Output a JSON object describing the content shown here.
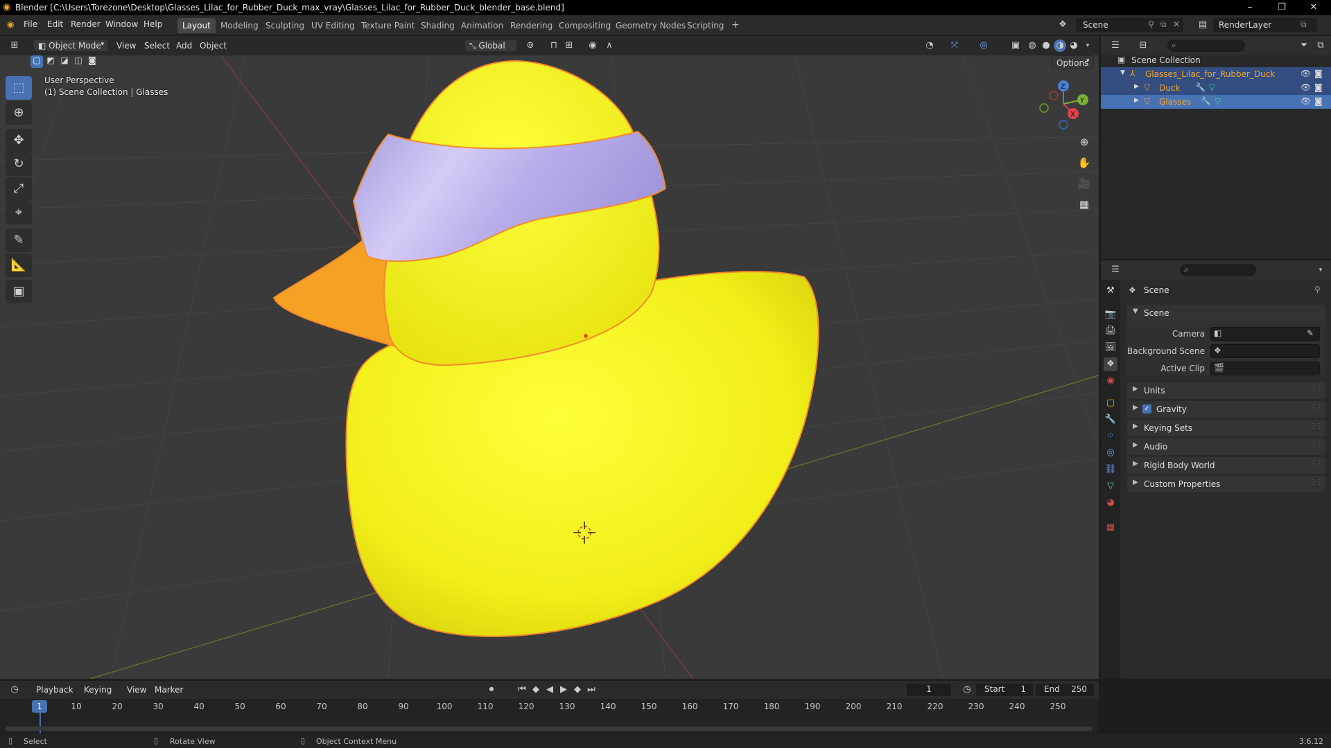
{
  "title_bar": {
    "title": "Blender [C:\\Users\\Torezone\\Desktop\\Glasses_Lilac_for_Rubber_Duck_max_vray\\Glasses_Lilac_for_Rubber_Duck_blender_base.blend]",
    "minimize": "–",
    "restore": "❐",
    "close": "✕"
  },
  "menu": {
    "file": "File",
    "edit": "Edit",
    "render": "Render",
    "window": "Window",
    "help": "Help"
  },
  "workspaces": [
    "Layout",
    "Modeling",
    "Sculpting",
    "UV Editing",
    "Texture Paint",
    "Shading",
    "Animation",
    "Rendering",
    "Compositing",
    "Geometry Nodes",
    "Scripting"
  ],
  "workspace_add": "+",
  "scene_selector": {
    "scene": "Scene",
    "render_layer": "RenderLayer"
  },
  "viewport_header": {
    "mode": "Object Mode",
    "view": "View",
    "select": "Select",
    "add": "Add",
    "object": "Object",
    "orientation": "Global",
    "options": "Options"
  },
  "viewport_info": {
    "perspective": "User Perspective",
    "collection": "(1) Scene Collection | Glasses"
  },
  "gizmo": {
    "z": "Z",
    "y": "Y",
    "x": "X"
  },
  "outliner": {
    "root": "Scene Collection",
    "items": [
      {
        "label": "Glasses_Lilac_for_Rubber_Duck",
        "level": 1
      },
      {
        "label": "Duck",
        "level": 2
      },
      {
        "label": "Glasses",
        "level": 2
      }
    ]
  },
  "properties": {
    "title": "Scene",
    "section_scene": "Scene",
    "camera_label": "Camera",
    "background_scene_label": "Background Scene",
    "active_clip_label": "Active Clip",
    "sections": [
      "Units",
      "Gravity",
      "Keying Sets",
      "Audio",
      "Rigid Body World",
      "Custom Properties"
    ]
  },
  "timeline": {
    "playback": "Playback",
    "keying": "Keying",
    "view": "View",
    "marker": "Marker",
    "current_frame": "1",
    "start_label": "Start",
    "start": "1",
    "end_label": "End",
    "end": "250",
    "ticks": [
      "1",
      "10",
      "20",
      "30",
      "40",
      "50",
      "60",
      "70",
      "80",
      "90",
      "100",
      "110",
      "120",
      "130",
      "140",
      "150",
      "160",
      "170",
      "180",
      "190",
      "200",
      "210",
      "220",
      "230",
      "240",
      "250"
    ]
  },
  "statusbar": {
    "select": "Select",
    "rotate": "Rotate View",
    "context": "Object Context Menu",
    "version": "3.6.12"
  },
  "colors": {
    "accent": "#4772b3",
    "duck_yellow": "#f4f21d",
    "beak_orange": "#f4a124",
    "glasses_lilac": "#b8aee8",
    "selection_outline": "#f58a2a"
  }
}
